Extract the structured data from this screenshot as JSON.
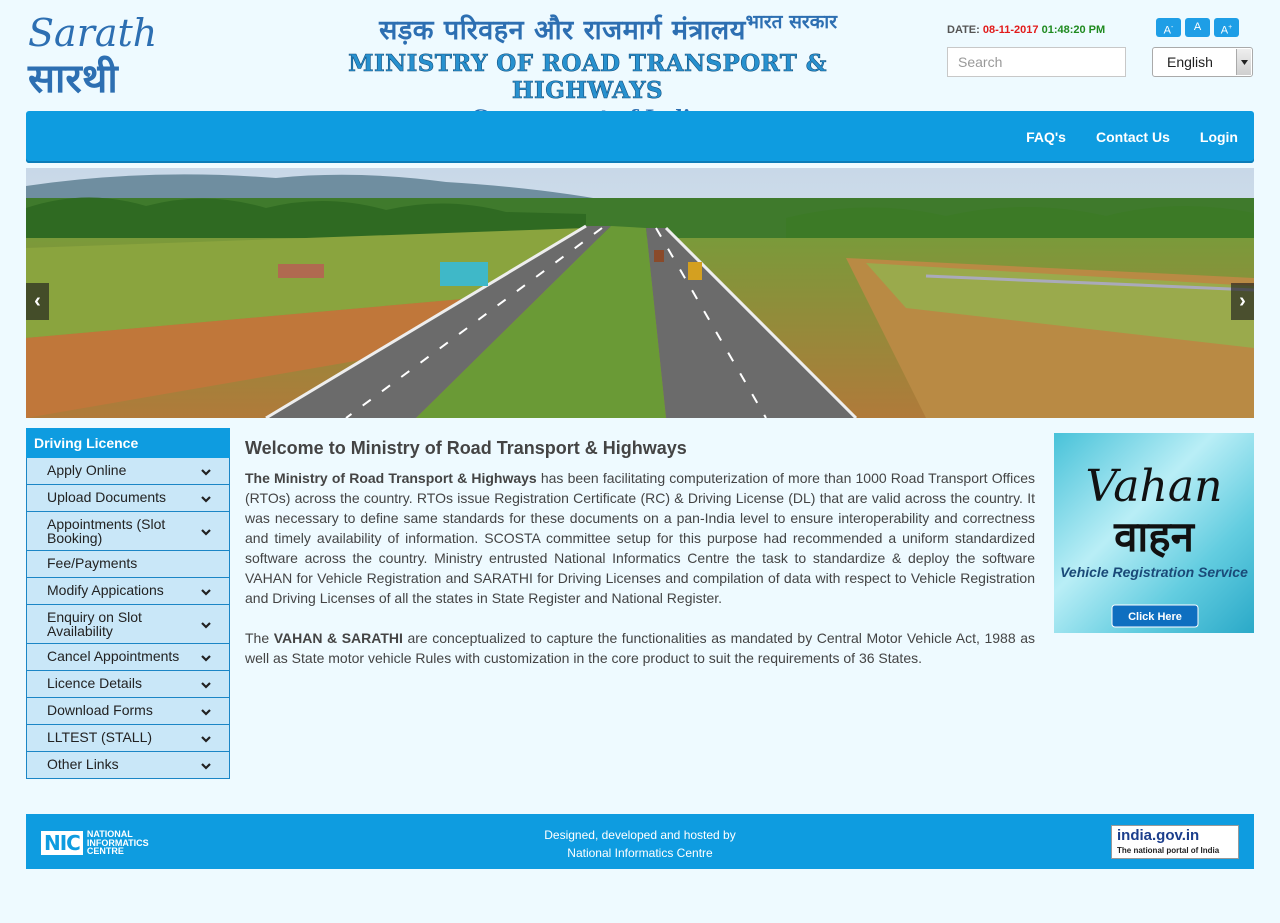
{
  "header": {
    "logo_english": "Sarathi",
    "logo_hindi": "सारथी",
    "ministry_hindi": "सड़क परिवहन और राजमार्ग मंत्रालय",
    "government_hindi": "भारत सरकार",
    "ministry_english": "MINISTRY OF ROAD TRANSPORT & HIGHWAYS",
    "government_english": "Government of India",
    "date_label": "DATE:",
    "date_value": "08-11-2017",
    "time_value": "01:48:20 PM",
    "font_decrease": "A",
    "font_normal": "A",
    "font_increase": "A",
    "font_decrease_sup": "-",
    "font_increase_sup": "+",
    "search_placeholder": "Search",
    "language_selected": "English"
  },
  "nav": {
    "items": [
      {
        "label": "FAQ's"
      },
      {
        "label": "Contact Us"
      },
      {
        "label": "Login"
      }
    ]
  },
  "carousel": {
    "prev_label": "‹",
    "next_label": "›"
  },
  "sidebar": {
    "heading": "Driving Licence",
    "items": [
      {
        "label": "Apply Online",
        "has_submenu": true
      },
      {
        "label": "Upload Documents",
        "has_submenu": true
      },
      {
        "label": "Appointments (Slot Booking)",
        "has_submenu": true
      },
      {
        "label": "Fee/Payments",
        "has_submenu": false
      },
      {
        "label": "Modify Appications",
        "has_submenu": true
      },
      {
        "label": "Enquiry on Slot Availability",
        "has_submenu": true
      },
      {
        "label": "Cancel Appointments",
        "has_submenu": true
      },
      {
        "label": "Licence Details",
        "has_submenu": true
      },
      {
        "label": "Download Forms",
        "has_submenu": true
      },
      {
        "label": "LLTEST (STALL)",
        "has_submenu": true
      },
      {
        "label": "Other Links",
        "has_submenu": true
      }
    ]
  },
  "main": {
    "title": "Welcome to Ministry of Road Transport & Highways",
    "p1_bold": "The Ministry of Road Transport & Highways",
    "p1_rest": " has been facilitating computerization of more than 1000 Road Transport Offices (RTOs) across the country. RTOs issue Registration Certificate (RC) & Driving License (DL) that are valid across the country. It was necessary to define same standards for these documents on a pan-India level to ensure interoperability and correctness and timely availability of information. SCOSTA committee setup for this purpose had recommended a uniform standardized software across the country. Ministry entrusted National Informatics Centre the task to standardize & deploy the software VAHAN for Vehicle Registration and SARATHI for Driving Licenses and compilation of data with respect to Vehicle Registration and Driving Licenses of all the states in State Register and National Register.",
    "p2_start": "The ",
    "p2_bold": "VAHAN & SARATHI",
    "p2_rest": " are conceptualized to capture the functionalities as mandated by Central Motor Vehicle Act, 1988 as well as State motor vehicle Rules with customization in the core product to suit the requirements of 36 States."
  },
  "vahan_banner": {
    "title_english": "Vahan",
    "title_hindi": "वाहन",
    "subtitle": "Vehicle Registration Service",
    "button": "Click Here"
  },
  "footer": {
    "nic_abbr": "NIC",
    "nic_line1": "NATIONAL",
    "nic_line2": "INFORMATICS",
    "nic_line3": "CENTRE",
    "credit_line1": "Designed, developed and hosted by",
    "credit_line2": "National Informatics Centre",
    "india_portal_title": "india.gov.in",
    "india_portal_sub": "The national portal of India"
  },
  "colors": {
    "primary_blue": "#0e9ce0",
    "sidebar_item_bg": "#c9e7f8",
    "page_bg": "#eefaff",
    "date_red": "#e21b1b",
    "time_green": "#1f8a1f"
  }
}
